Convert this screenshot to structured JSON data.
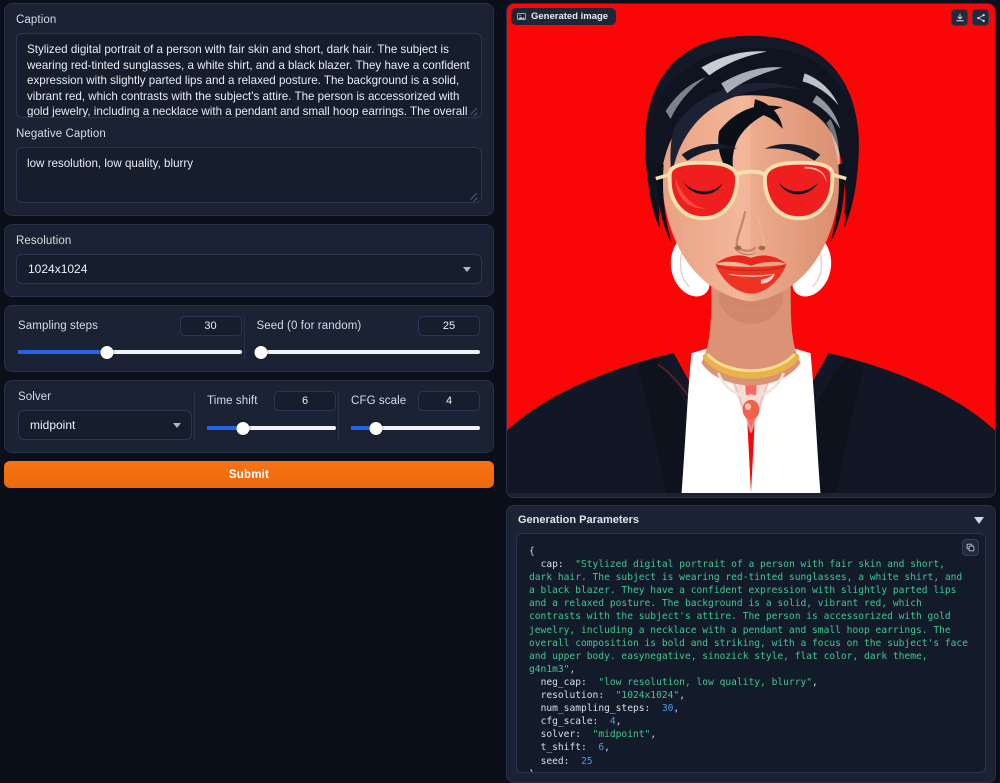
{
  "form": {
    "caption_label": "Caption",
    "caption_value": "Stylized digital portrait of a person with fair skin and short, dark hair. The subject is wearing red-tinted sunglasses, a white shirt, and a black blazer. They have a confident expression with slightly parted lips and a relaxed posture. The background is a solid, vibrant red, which contrasts with the subject's attire. The person is accessorized with gold jewelry, including a necklace with a pendant and small hoop earrings. The overall composition is bold and striking, with a focus on the subject's face and upper body. easynegative, sinozick style, flat color, dark theme, g4n1m3",
    "negative_label": "Negative Caption",
    "negative_value": "low resolution, low quality, blurry",
    "resolution_label": "Resolution",
    "resolution_value": "1024x1024",
    "sampling_steps_label": "Sampling steps",
    "sampling_steps_value": "30",
    "seed_label": "Seed (0 for random)",
    "seed_value": "25",
    "solver_label": "Solver",
    "solver_value": "midpoint",
    "time_shift_label": "Time shift",
    "time_shift_value": "6",
    "cfg_scale_label": "CFG scale",
    "cfg_scale_value": "4",
    "submit_label": "Submit"
  },
  "sliders": {
    "sampling_steps_pct": 40,
    "seed_pct": 2,
    "time_shift_pct": 28,
    "cfg_scale_pct": 19,
    "fill_color": "#2563eb",
    "track_color": "#f1f3f8"
  },
  "image_panel": {
    "badge_label": "Generated image",
    "badge_icon": "image-icon",
    "download_icon": "download-icon",
    "share_icon": "share-icon",
    "background_color": "#fb0606",
    "alt": "Stylized flat-color digital portrait of a person with short dark hair, red-tinted round sunglasses, red lips, gold hoop earrings, gold necklace with pendant, white shirt and black blazer on vibrant red background"
  },
  "generation_parameters": {
    "title": "Generation Parameters",
    "collapse_icon": "chevron-down-icon",
    "copy_icon": "copy-icon",
    "json": {
      "open_brace": "{",
      "close_brace": "}",
      "entries": [
        {
          "key": "cap",
          "value": "\"Stylized digital portrait of a person with fair skin and short, dark hair. The subject is wearing red-tinted sunglasses, a white shirt, and a black blazer. They have a confident expression with slightly parted lips and a relaxed posture. The background is a solid, vibrant red, which contrasts with the subject's attire. The person is accessorized with gold jewelry, including a necklace with a pendant and small hoop earrings. The overall composition is bold and striking, with a focus on the subject's face and upper body. easynegative, sinozick style, flat color, dark theme, g4n1m3\"",
          "type": "string"
        },
        {
          "key": "neg_cap",
          "value": "\"low resolution, low quality, blurry\"",
          "type": "string"
        },
        {
          "key": "resolution",
          "value": "\"1024x1024\"",
          "type": "string"
        },
        {
          "key": "num_sampling_steps",
          "value": "30",
          "type": "number"
        },
        {
          "key": "cfg_scale",
          "value": "4",
          "type": "number"
        },
        {
          "key": "solver",
          "value": "\"midpoint\"",
          "type": "string"
        },
        {
          "key": "t_shift",
          "value": "6",
          "type": "number"
        },
        {
          "key": "seed",
          "value": "25",
          "type": "number"
        }
      ]
    }
  }
}
